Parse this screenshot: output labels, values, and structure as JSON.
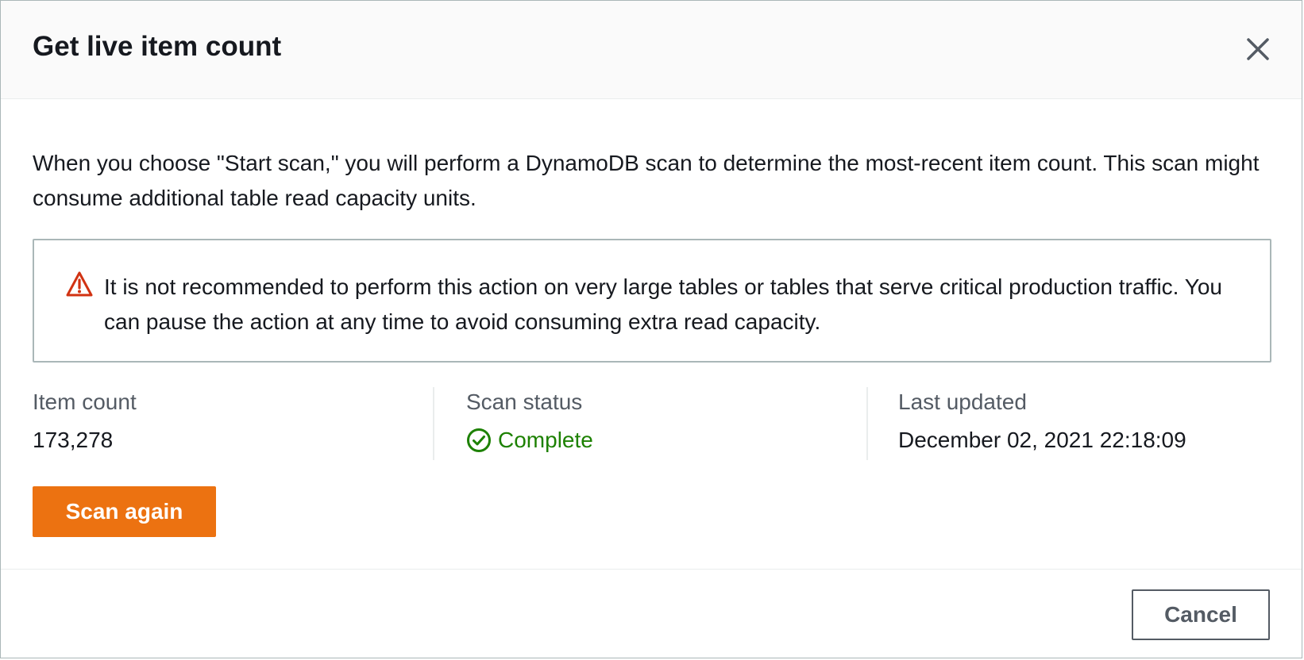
{
  "modal": {
    "title": "Get live item count",
    "close_icon": "close-icon"
  },
  "intro_text": "When you choose \"Start scan,\" you will perform a DynamoDB scan to determine the most-recent item count. This scan might consume additional table read capacity units.",
  "alert": {
    "icon": "warning-icon",
    "text": "It is not recommended to perform this action on very large tables or tables that serve critical production traffic. You can pause the action at any time to avoid consuming extra read capacity."
  },
  "stats": {
    "item_count": {
      "label": "Item count",
      "value": "173,278"
    },
    "scan_status": {
      "label": "Scan status",
      "value": "Complete",
      "icon": "check-circle-icon"
    },
    "last_updated": {
      "label": "Last updated",
      "value": "December 02, 2021 22:18:09"
    }
  },
  "actions": {
    "scan_again_label": "Scan again",
    "cancel_label": "Cancel"
  },
  "colors": {
    "accent": "#ec7211",
    "success": "#1d8102",
    "warning": "#d13212",
    "text": "#16191f",
    "secondary_text": "#545b64"
  }
}
